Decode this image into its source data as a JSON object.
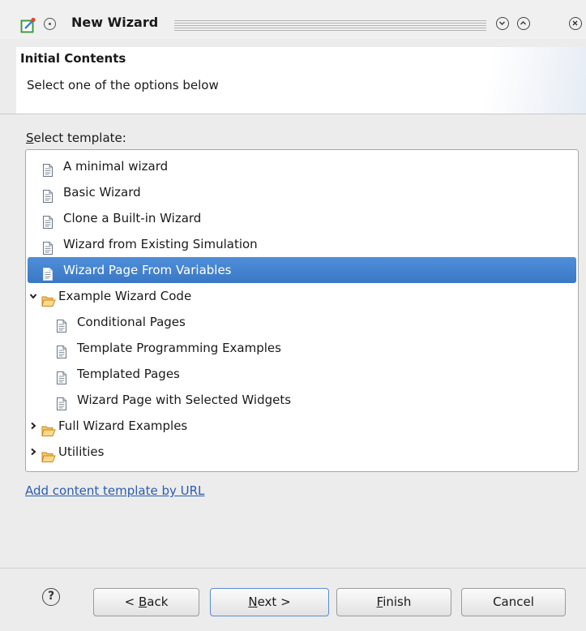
{
  "window": {
    "title": "New Wizard"
  },
  "header": {
    "title": "Initial Contents",
    "description": "Select one of the options below"
  },
  "templates": {
    "label_mnemonic": "S",
    "label_rest": "elect template:",
    "items": [
      {
        "label": "A minimal wizard",
        "type": "file",
        "depth": 0,
        "selected": false
      },
      {
        "label": "Basic Wizard",
        "type": "file",
        "depth": 0,
        "selected": false
      },
      {
        "label": "Clone a Built-in Wizard",
        "type": "file",
        "depth": 0,
        "selected": false
      },
      {
        "label": "Wizard from Existing Simulation",
        "type": "file",
        "depth": 0,
        "selected": false
      },
      {
        "label": "Wizard Page From Variables",
        "type": "file",
        "depth": 0,
        "selected": true
      },
      {
        "label": "Example Wizard Code",
        "type": "folder",
        "depth": 0,
        "expanded": true
      },
      {
        "label": "Conditional Pages",
        "type": "file",
        "depth": 1,
        "selected": false
      },
      {
        "label": "Template Programming Examples",
        "type": "file",
        "depth": 1,
        "selected": false
      },
      {
        "label": "Templated Pages",
        "type": "file",
        "depth": 1,
        "selected": false
      },
      {
        "label": "Wizard Page with Selected Widgets",
        "type": "file",
        "depth": 1,
        "selected": false
      },
      {
        "label": "Full Wizard Examples",
        "type": "folder",
        "depth": 0,
        "expanded": false
      },
      {
        "label": "Utilities",
        "type": "folder",
        "depth": 0,
        "expanded": false
      }
    ]
  },
  "add_link": "Add content template by URL",
  "buttons": {
    "back_prefix": "< ",
    "back_mnemonic": "B",
    "back_rest": "ack",
    "next_mnemonic": "N",
    "next_rest": "ext >",
    "finish_mnemonic": "F",
    "finish_rest": "inish",
    "cancel": "Cancel"
  },
  "colors": {
    "selection": "#3a78c5",
    "link": "#2b5cb0",
    "folder": "#e8a33c"
  }
}
